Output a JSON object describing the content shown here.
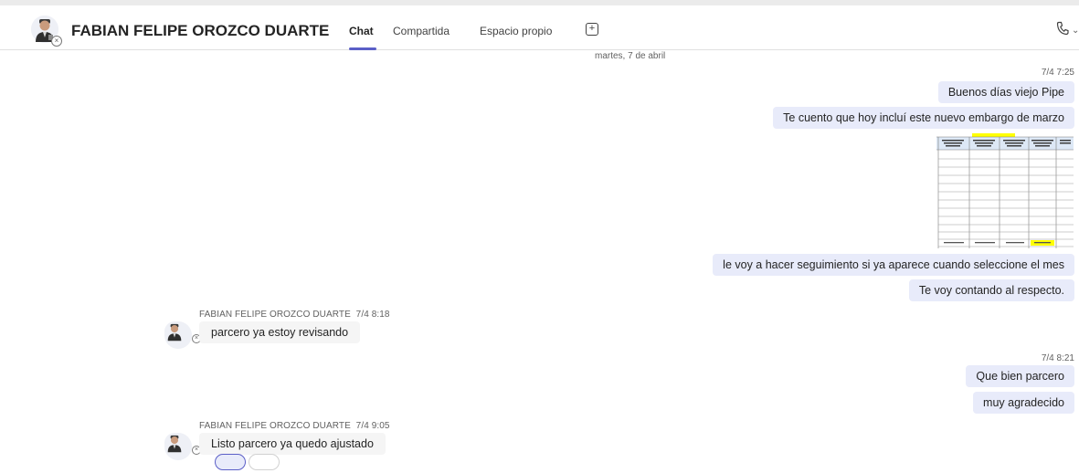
{
  "header": {
    "contact_name": "FABIAN FELIPE OROZCO DUARTE",
    "tabs": [
      {
        "label": "Chat",
        "active": true
      },
      {
        "label": "Compartida",
        "active": false
      },
      {
        "label": "Espacio propio",
        "active": false
      }
    ],
    "add_tab_icon": "plus-icon",
    "call_icon": "phone-icon"
  },
  "chat": {
    "date_separator": "martes, 7 de abril",
    "groups": [
      {
        "sender": "me",
        "time": "7/4 7:25",
        "messages": [
          "Buenos días viejo Pipe",
          "Te cuento que hoy incluí este nuevo embargo de marzo",
          "le voy a hacer seguimiento si ya aparece cuando seleccione el mes",
          "Te voy contando al respecto."
        ],
        "attachment": "spreadsheet-image"
      },
      {
        "sender": "FABIAN FELIPE OROZCO DUARTE",
        "time": "7/4 8:18",
        "messages": [
          "parcero ya estoy revisando"
        ]
      },
      {
        "sender": "me",
        "time": "7/4 8:21",
        "messages": [
          "Que bien parcero",
          "muy agradecido"
        ]
      },
      {
        "sender": "FABIAN FELIPE OROZCO DUARTE",
        "time": "7/4 9:05",
        "messages": [
          "Listo parcero ya quedo ajustado"
        ]
      }
    ]
  },
  "colors": {
    "accent": "#5b5fc7",
    "outgoing_bubble": "#e8ebfa",
    "incoming_bubble": "#f5f5f5",
    "highlight_yellow": "#ffff00"
  }
}
